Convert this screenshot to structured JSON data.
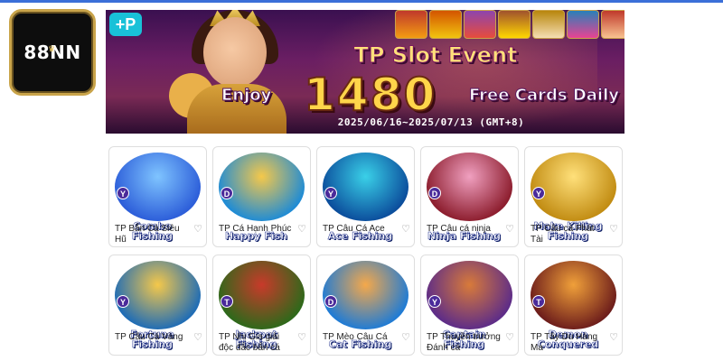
{
  "logo": {
    "text": "88NN",
    "crown": "♛"
  },
  "banner": {
    "badge": "+P",
    "title": "TP Slot Event",
    "enjoy": "Enjoy",
    "number": "1480",
    "free": "Free Cards Daily",
    "dates": "2025/06/16~2025/07/13 (GMT+8)"
  },
  "games": [
    {
      "name": "TP Bắn Cá Siêu Hũ",
      "logo": "Combo Fishing",
      "badge": "Y",
      "colors": [
        "#2a5bd8",
        "#7fc4ff"
      ]
    },
    {
      "name": "TP Cá Hạnh Phúc",
      "logo": "Happy Fish",
      "badge": "D",
      "colors": [
        "#1a8ad8",
        "#f5c84a"
      ]
    },
    {
      "name": "TP Câu Cá Ace",
      "logo": "Ace Fishing",
      "badge": "Y",
      "colors": [
        "#0a4a9a",
        "#3ad0e8"
      ]
    },
    {
      "name": "TP Câu cá ninja",
      "logo": "Ninja Fishing",
      "badge": "D",
      "colors": [
        "#8a1a2a",
        "#f0a0c0"
      ]
    },
    {
      "name": "TP Câu cá Phát Tài",
      "logo": "Make Killing Fishing",
      "badge": "Y",
      "colors": [
        "#c08a10",
        "#ffe07a"
      ]
    },
    {
      "name": "TP Câu Cá Vàng",
      "logo": "Fortune Fishing",
      "badge": "Y",
      "colors": [
        "#1a6ab8",
        "#f5c84a"
      ]
    },
    {
      "name": "TP Nhị Gia giải độc đắc bắn cá",
      "logo": "Jackpot Fishing",
      "badge": "T",
      "colors": [
        "#2a6a1a",
        "#c83a2a"
      ]
    },
    {
      "name": "TP Mèo Câu Cá",
      "logo": "Cat Fishing",
      "badge": "D",
      "colors": [
        "#1a7ad8",
        "#f5a84a"
      ]
    },
    {
      "name": "TP Thuyền trưởng Đánh cá",
      "logo": "Captain Fishing",
      "badge": "Y",
      "colors": [
        "#5a2a8a",
        "#d87a3a"
      ]
    },
    {
      "name": "TP Tây Du Hàng Ma",
      "logo": "Demon Conquered",
      "badge": "T",
      "colors": [
        "#6a1a1a",
        "#f0a03a"
      ]
    }
  ],
  "favorite_icon": "heart-outline-icon"
}
